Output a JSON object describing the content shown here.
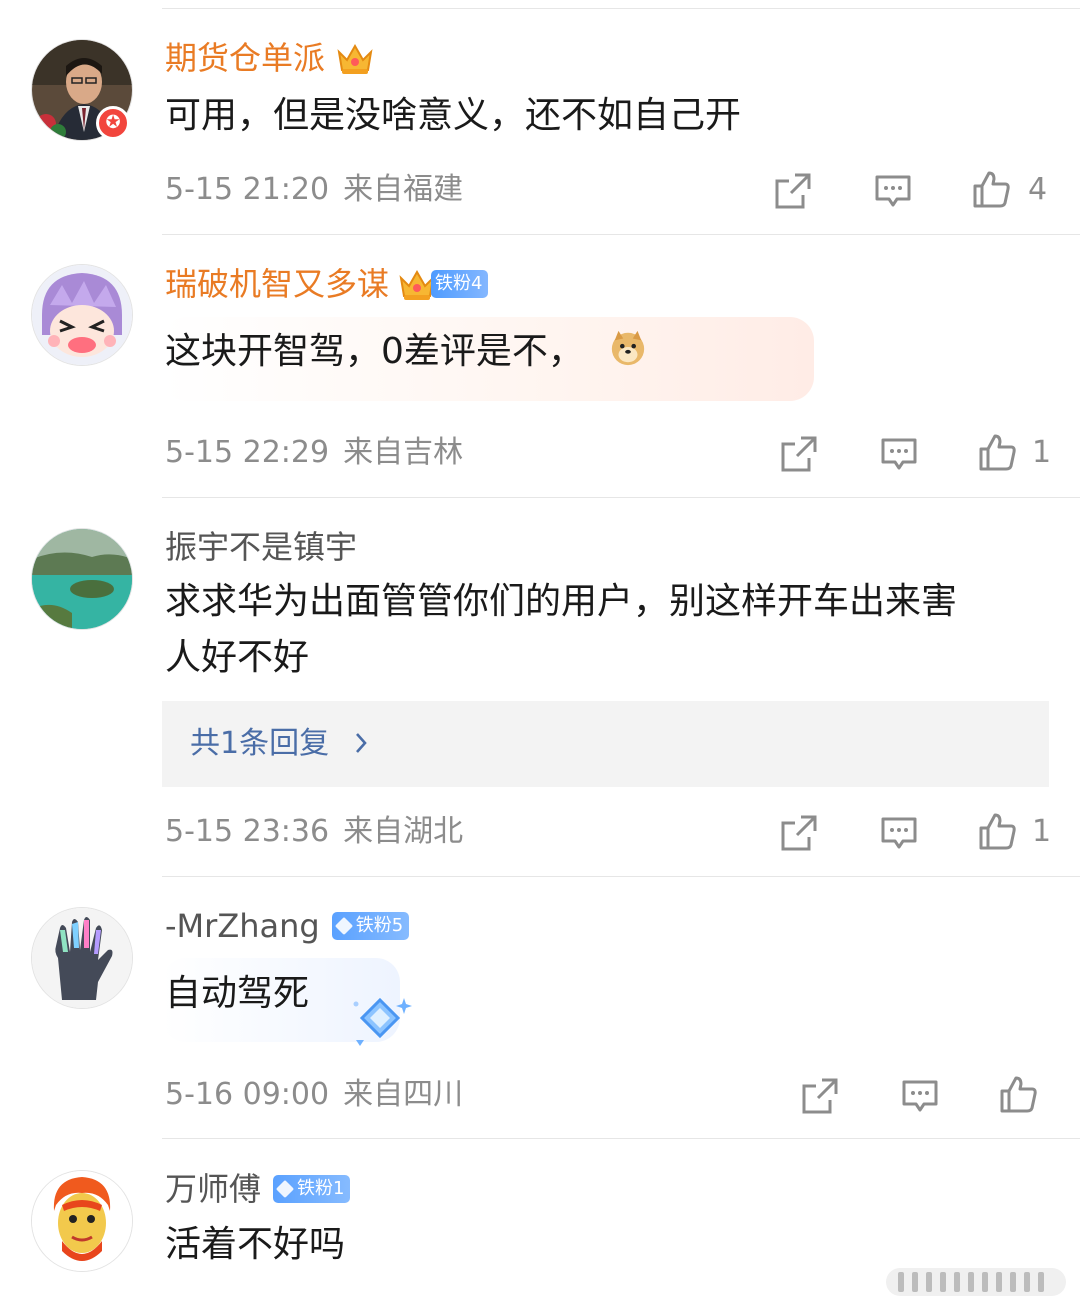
{
  "comments": [
    {
      "username": "期货仓单派",
      "fan_badge": "",
      "text": "可用，但是没啥意义，还不如自己开",
      "time": "5-15 21:20",
      "location": "来自福建",
      "likes": "4"
    },
    {
      "username": "瑞破机智又多谋",
      "fan_badge": "铁粉4",
      "text": "这块开智驾，0差评是不，",
      "emoji": "doge-emoji",
      "time": "5-15 22:29",
      "location": "来自吉林",
      "likes": "1"
    },
    {
      "username": "振宇不是镇宇",
      "text_line1": "求求华为出面管管你们的用户，别这样开车出来害",
      "text_line2": "人好不好",
      "reply_link": "共1条回复",
      "time": "5-15 23:36",
      "location": "来自湖北",
      "likes": "1"
    },
    {
      "username": "-MrZhang",
      "fan_badge": "铁粉5",
      "text": "自动驾死",
      "time": "5-16 09:00",
      "location": "来自四川",
      "likes": ""
    },
    {
      "username": "万师傅",
      "fan_badge": "铁粉1",
      "text": "活着不好吗"
    }
  ],
  "icons": {
    "share": "share-icon",
    "comment": "comment-icon",
    "like": "thumbs-up-icon",
    "verified": "verified-badge-icon",
    "crown": "crown-icon"
  },
  "colors": {
    "gold_username": "#e97b24",
    "link": "#4a6da7",
    "meta": "#8c8c8c",
    "verified_red": "#f2453d"
  }
}
